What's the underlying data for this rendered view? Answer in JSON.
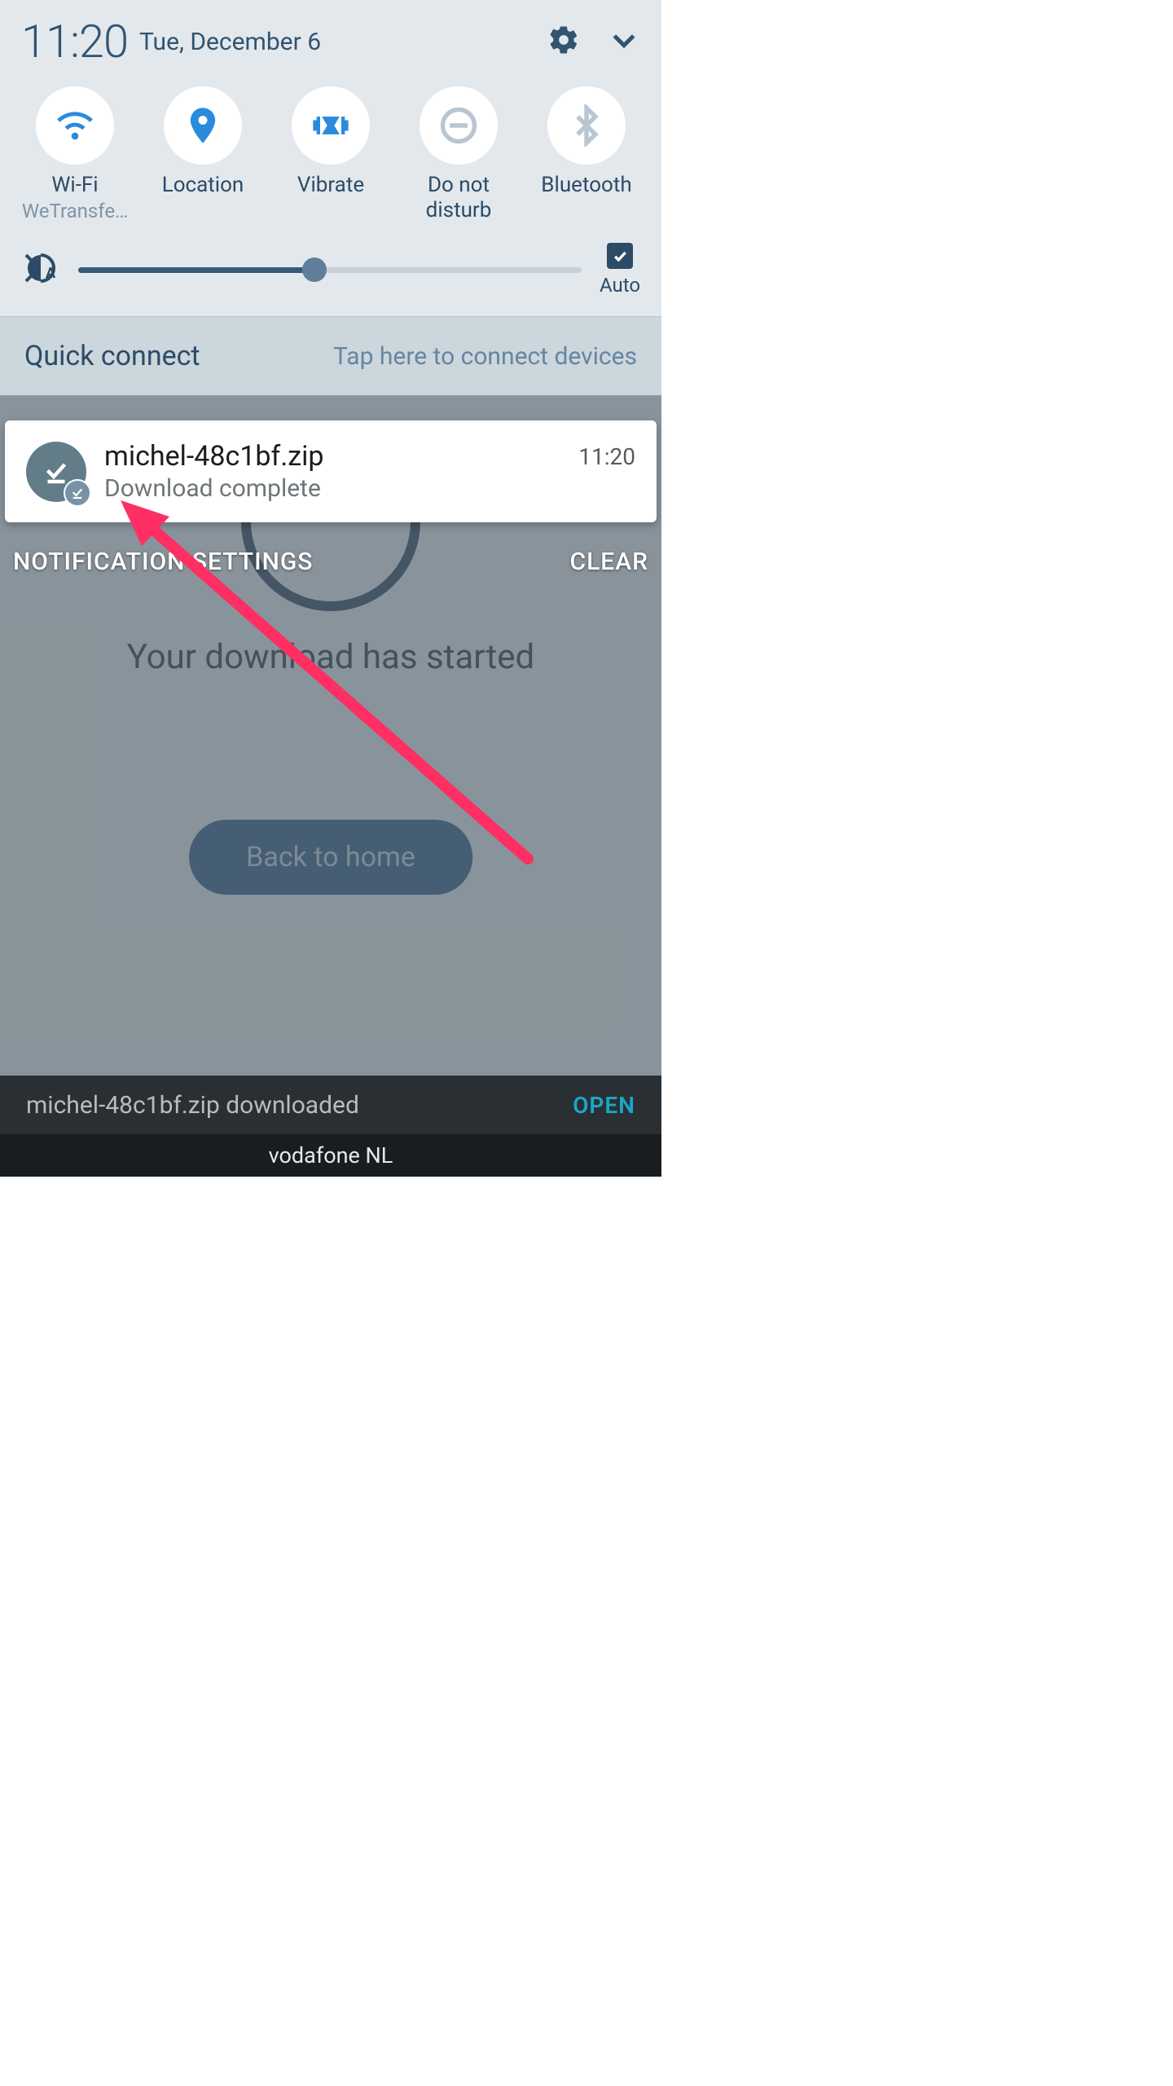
{
  "status": {
    "time": "11:20",
    "date": "Tue, December 6"
  },
  "qs": {
    "wifi": {
      "label": "Wi-Fi",
      "sub": "WeTransfe…"
    },
    "location": {
      "label": "Location"
    },
    "vibrate": {
      "label": "Vibrate"
    },
    "dnd": {
      "label": "Do not\ndisturb"
    },
    "bluetooth": {
      "label": "Bluetooth"
    }
  },
  "brightness": {
    "auto_label": "Auto",
    "value_pct": 47
  },
  "quick_connect": {
    "title": "Quick connect",
    "hint": "Tap here to connect devices"
  },
  "notification": {
    "title": "michel-48c1bf.zip",
    "subtitle": "Download complete",
    "time": "11:20"
  },
  "shade_footer": {
    "settings": "NOTIFICATION SETTINGS",
    "clear": "CLEAR"
  },
  "bg": {
    "headline": "Your download has started",
    "home_btn": "Back to home"
  },
  "snackbar": {
    "text": "michel-48c1bf.zip downloaded",
    "action": "OPEN"
  },
  "carrier": "vodafone NL",
  "colors": {
    "accent_active": "#2a8bdc",
    "accent_inactive": "#b7c6d2"
  }
}
